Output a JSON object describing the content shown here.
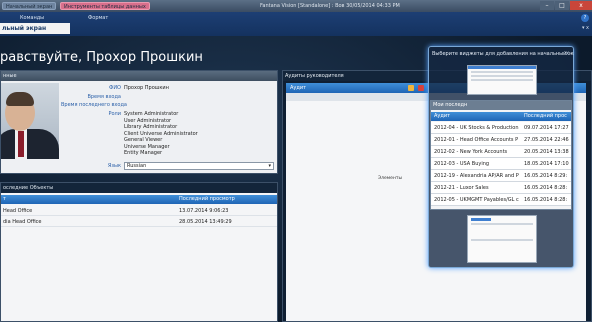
{
  "titlebar": {
    "quick_tab_1": "Начальный экран",
    "quick_tab_2": "Инструменты таблицы данных",
    "title": "Fantana Vision [Standalone] : Вов 30/05/2014 04:33 PM",
    "min": "–",
    "max": "□",
    "close": "x"
  },
  "ribbon": {
    "tab_1": "Команды",
    "tab_2": "Формат",
    "active_tab": "льный экран",
    "help": "?",
    "pin": "▾ x"
  },
  "welcome": "равствуйте, Прохор Прошкин",
  "user_panel": {
    "header": "нные",
    "fields": [
      {
        "label": "ФИО",
        "value": "Прохор Прошкин"
      },
      {
        "label": "Время входа",
        "value": ""
      },
      {
        "label": "Время последнего входа",
        "value": ""
      },
      {
        "label": "Роли",
        "value": ""
      }
    ],
    "roles": [
      "System Administrator",
      "User Administrator",
      "Library Administrator",
      "Client Universe Administrator",
      "General Viewer",
      "Universe Manager",
      "Entity Manager"
    ],
    "language_label": "Язык",
    "language_value": "Russian"
  },
  "recent_panel": {
    "header": "оследние Объекты",
    "col_name": "т",
    "col_viewed": "Последний просмотр",
    "rows": [
      {
        "name": "Head Office",
        "viewed": "13.07.2014 9:06:23"
      },
      {
        "name": "dia Head Office",
        "viewed": "28.05.2014 13:49:29"
      }
    ]
  },
  "audit_panel": {
    "header": "Аудиты руководителя",
    "col_audit": "Аудит",
    "hint": "Элементы"
  },
  "popup": {
    "title": "Выберите виджеты для добавления на начальный эк",
    "close": "x"
  },
  "widget": {
    "header": "Мои последн",
    "col_audit": "Аудит",
    "col_viewed": "Последний прос",
    "rows": [
      {
        "audit": "2012-04 - UK Stocks & Production",
        "viewed": "09.07.2014 17:27"
      },
      {
        "audit": "2012-01 - Head Office Accounts P",
        "viewed": "27.05.2014 22:46"
      },
      {
        "audit": "2012-02 - New York Accounts",
        "viewed": "20.05.2014 13:38"
      },
      {
        "audit": "2012-03 - USA Buying",
        "viewed": "18.05.2014 17:10"
      },
      {
        "audit": "2012-19 - Alexandria AP/AR and P",
        "viewed": "16.05.2014 8:29:"
      },
      {
        "audit": "2012-21 - Luxor Sales",
        "viewed": "16.05.2014 8:28:"
      },
      {
        "audit": "2012-05 - UKMGMT Payables/GL c",
        "viewed": "16.05.2014 8:28:"
      }
    ]
  }
}
